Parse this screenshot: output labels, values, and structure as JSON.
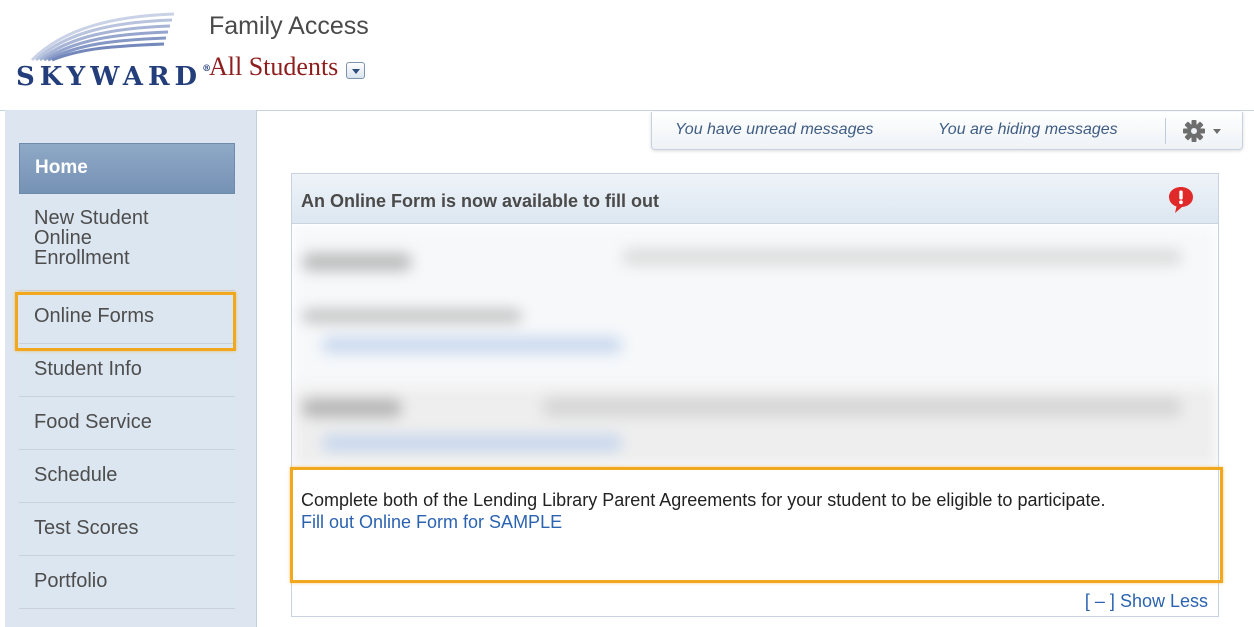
{
  "header": {
    "brand": "SKYWARD",
    "app_title": "Family Access",
    "student_selector": "All Students"
  },
  "sidebar": {
    "items": [
      {
        "label": "Home",
        "active": true
      },
      {
        "label": "New Student Online Enrollment",
        "lines": [
          "New Student",
          "Online",
          "Enrollment"
        ]
      },
      {
        "label": "Online Forms",
        "highlighted": true
      },
      {
        "label": "Student Info"
      },
      {
        "label": "Food Service"
      },
      {
        "label": "Schedule"
      },
      {
        "label": "Test Scores"
      },
      {
        "label": "Portfolio"
      }
    ]
  },
  "messages": {
    "unread": "You have unread messages",
    "hiding": "You are hiding messages"
  },
  "panel": {
    "title": "An Online Form is now available to fill out",
    "notice_text": "Complete both of the Lending Library Parent Agreements for your student to be eligible to participate.",
    "link_text": "Fill out Online Form for SAMPLE",
    "toggle_text": "[ – ] Show Less"
  },
  "colors": {
    "highlight": "#f1a81f",
    "link": "#2b63b0",
    "student_selector": "#8e1d1d",
    "brand": "#233e7a",
    "nav_active": "#7f9bbd",
    "alert": "#e02a2a"
  },
  "icons": {
    "alert": "exclamation-bubble-icon",
    "settings": "gear-icon",
    "dropdown": "chevron-down-icon"
  }
}
